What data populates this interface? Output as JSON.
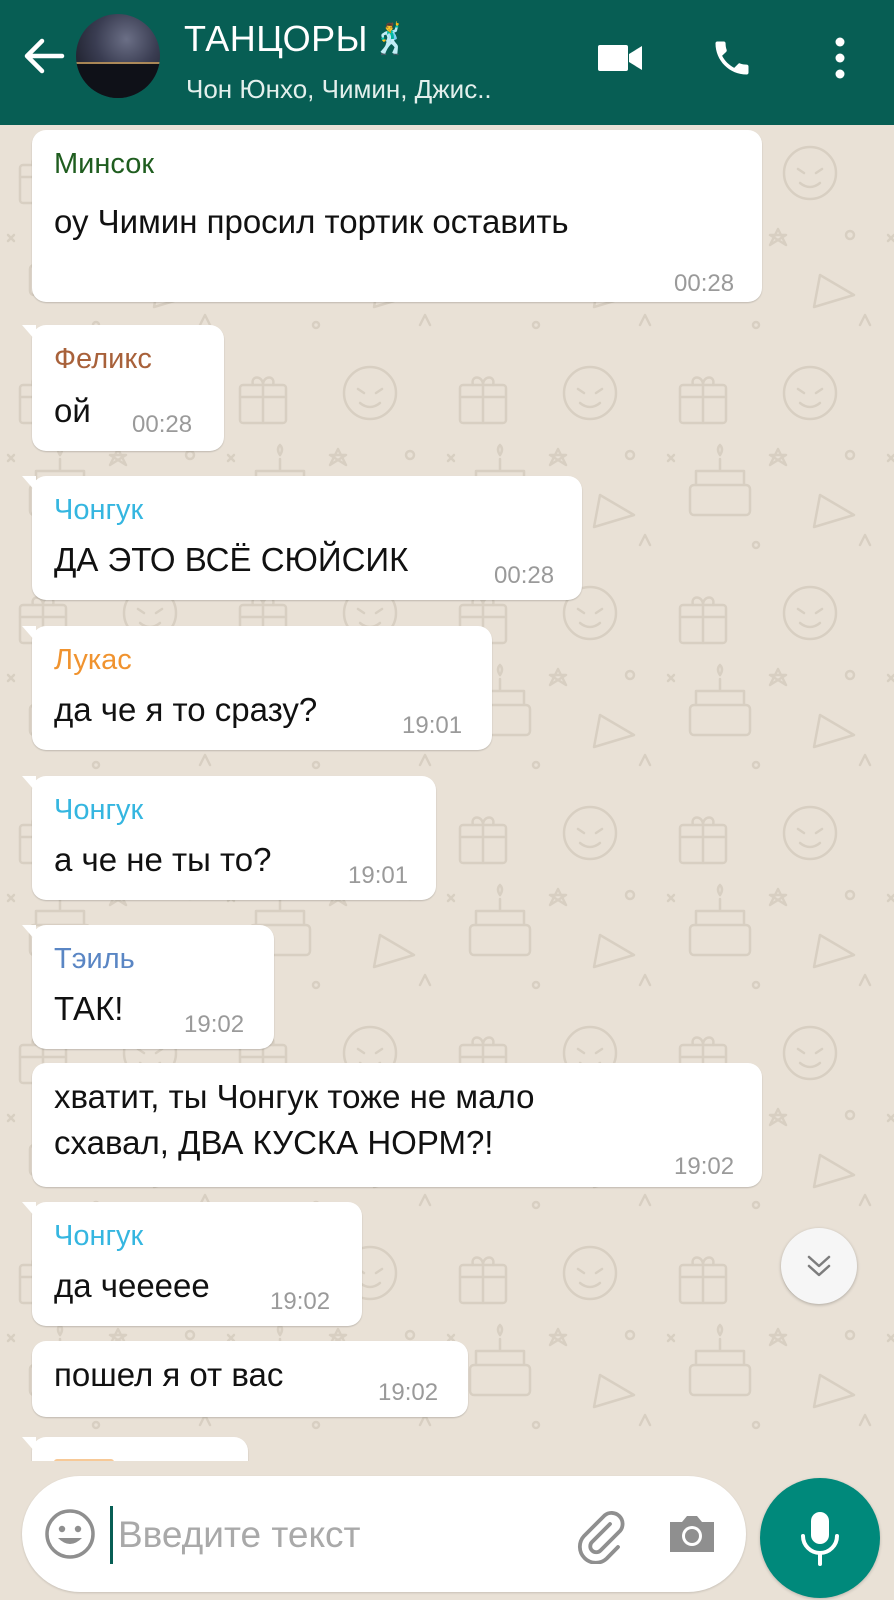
{
  "header": {
    "title": "ТАНЦОРЫ",
    "title_emoji": "🕺",
    "subtitle": "Чон Юнхо, Чимин, Джис..",
    "icons": {
      "back": "arrow-left-icon",
      "avatar": "group-avatar",
      "video": "video-call-icon",
      "call": "phone-icon",
      "menu": "more-vertical-icon"
    }
  },
  "messages": [
    {
      "sender": "Минсок",
      "sender_color": "#1f5d1f",
      "text": "оу Чимин просил тортик оставить",
      "time": "00:28"
    },
    {
      "sender": "Феликс",
      "sender_color": "#a8613a",
      "text": "ой",
      "time": "00:28"
    },
    {
      "sender": "Чонгук",
      "sender_color": "#35b6e0",
      "text": "ДА ЭТО ВСЁ СЮЙСИК",
      "time": "00:28"
    },
    {
      "sender": "Лукас",
      "sender_color": "#f0932f",
      "text": "да че я то сразу?",
      "time": "19:01"
    },
    {
      "sender": "Чонгук",
      "sender_color": "#35b6e0",
      "text": "а че не ты то?",
      "time": "19:01"
    },
    {
      "sender": "Тэиль",
      "sender_color": "#5a86c4",
      "text": "ТАК!",
      "time": "19:02"
    },
    {
      "sender": "",
      "text_line1": "хватит, ты Чонгук тоже не мало",
      "text_line2": "схавал, ДВА КУСКА НОРМ?!",
      "time": "19:02"
    },
    {
      "sender": "Чонгук",
      "sender_color": "#35b6e0",
      "text": "да чеееее",
      "time": "19:02"
    },
    {
      "sender": "",
      "text": "пошел я от вас",
      "time": "19:02"
    }
  ],
  "scroll_button": {
    "icon": "chevron-double-down-icon"
  },
  "input": {
    "placeholder": "Введите текст",
    "icons": {
      "emoji": "emoji-icon",
      "attach": "paperclip-icon",
      "camera": "camera-icon",
      "mic": "microphone-icon"
    }
  },
  "colors": {
    "header_bg": "#075e54",
    "chat_bg": "#e9e1d6",
    "bubble_bg": "#ffffff",
    "mic_button": "#00897b"
  }
}
